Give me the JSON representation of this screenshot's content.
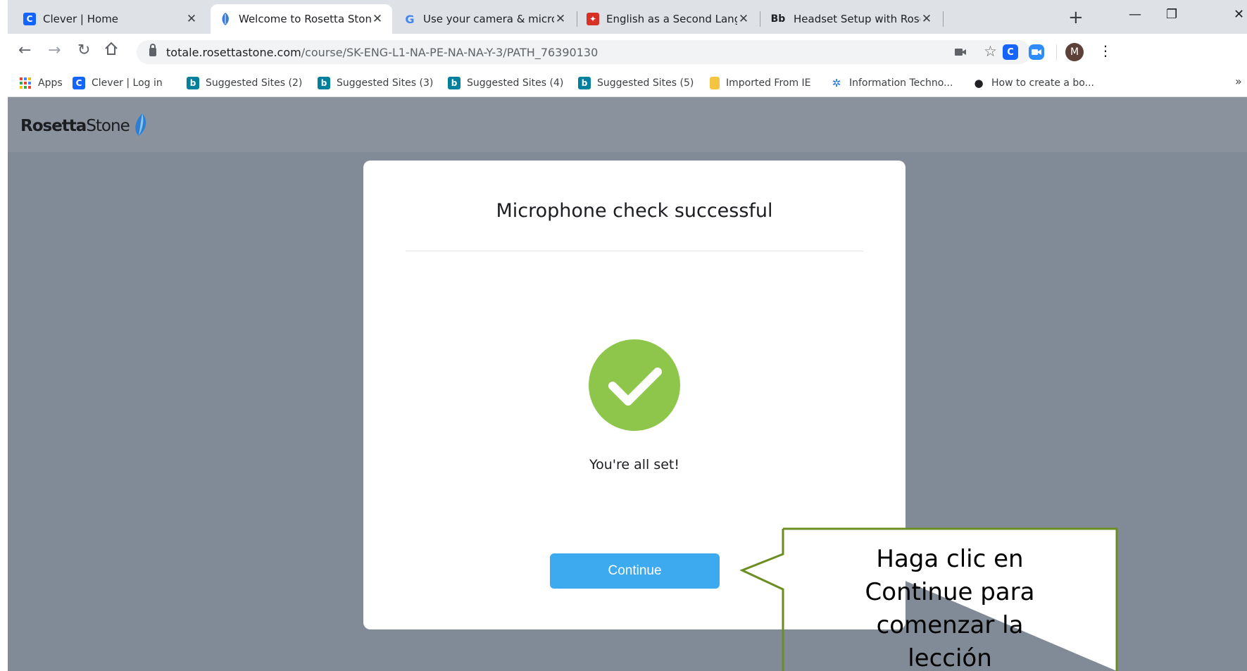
{
  "browser": {
    "tabs": [
      {
        "title": "Clever | Home",
        "favicon": "C",
        "favicon_color": "#1464ff",
        "active": false
      },
      {
        "title": "Welcome to Rosetta Stone!",
        "favicon": "rosetta-leaf",
        "favicon_color": "#3a7bd5",
        "active": true
      },
      {
        "title": "Use your camera & microphon",
        "favicon": "G",
        "favicon_color": "#4285f4",
        "active": false
      },
      {
        "title": "English as a Second Language",
        "favicon": "bookmark-red",
        "favicon_color": "#d93025",
        "active": false
      },
      {
        "title": "Headset Setup with Rosetta St",
        "favicon": "Bb",
        "favicon_color": "#202124",
        "active": false
      }
    ],
    "new_tab_label": "+",
    "window_controls": {
      "minimize": "—",
      "restore": "❐",
      "close": "✕"
    },
    "url": {
      "host": "totale.rosettastone.com",
      "path": "/course/SK-ENG-L1-NA-PE-NA-NA-Y-3/PATH_76390130"
    },
    "profile_initial": "M",
    "bookmarks": [
      {
        "label": "Apps",
        "icon": "apps-grid-icon"
      },
      {
        "label": "Clever | Log in",
        "icon": "C",
        "color": "#1464ff"
      },
      {
        "label": "Suggested Sites (2)",
        "icon": "b",
        "color": "#00809d"
      },
      {
        "label": "Suggested Sites (3)",
        "icon": "b",
        "color": "#00809d"
      },
      {
        "label": "Suggested Sites (4)",
        "icon": "b",
        "color": "#00809d"
      },
      {
        "label": "Suggested Sites (5)",
        "icon": "b",
        "color": "#00809d"
      },
      {
        "label": "Imported From IE",
        "icon": "folder-icon",
        "color": "#f4c542"
      },
      {
        "label": "Information Techno...",
        "icon": "it-icon",
        "color": "#1a73e8"
      },
      {
        "label": "How to create a bo...",
        "icon": "apple-icon",
        "color": "#202124"
      }
    ],
    "bookmarks_overflow": "»"
  },
  "page": {
    "logo": {
      "bold": "Rosetta",
      "regular": "Stone"
    },
    "card": {
      "title": "Microphone check successful",
      "subtitle": "You're all set!",
      "continue_label": "Continue"
    },
    "callout": {
      "lines": [
        "Haga clic en",
        "Continue para",
        "comenzar la",
        "lección"
      ],
      "border_color": "#6b8e23"
    }
  },
  "colors": {
    "page_bg": "#818a97",
    "header_bg": "#8a929e",
    "check_green": "#8dc64b",
    "button_blue": "#3da9ee"
  }
}
